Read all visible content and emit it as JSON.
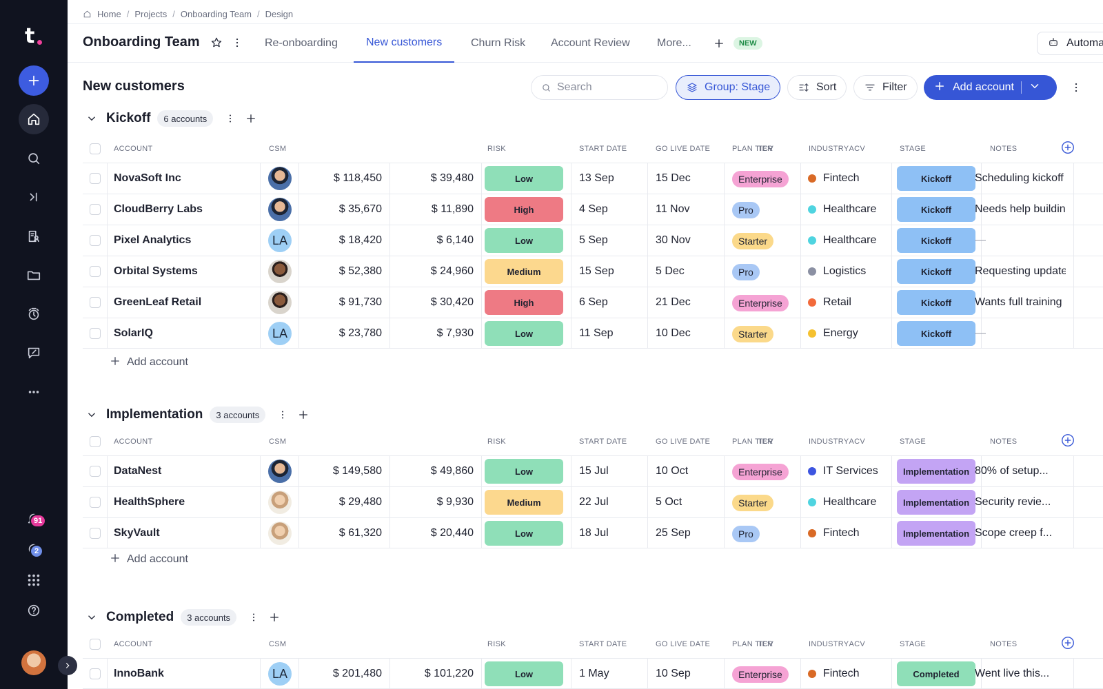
{
  "breadcrumb": [
    "Home",
    "Projects",
    "Onboarding Team",
    "Design"
  ],
  "header": {
    "title": "Onboarding Team",
    "tabs": [
      "Re-onboarding",
      "New customers",
      "Churn Risk",
      "Account Review",
      "More..."
    ],
    "active_tab": "New customers",
    "new_badge": "NEW",
    "automate_label": "Automate"
  },
  "sidebar": {
    "notifications_count": "91",
    "messages_count": "2",
    "icons": [
      "plus-icon",
      "home-icon",
      "search-icon",
      "skip-forward-icon",
      "user-list-icon",
      "folder-icon",
      "timer-icon",
      "feedback-icon",
      "more-horizontal-icon",
      "bell-icon",
      "chat-icon",
      "apps-grid-icon",
      "help-icon"
    ]
  },
  "toolbar": {
    "section_title": "New customers",
    "search_placeholder": "Search",
    "group_label": "Group: Stage",
    "sort_label": "Sort",
    "filter_label": "Filter",
    "add_account_label": "Add account"
  },
  "columns": [
    "ACCOUNT",
    "CSM",
    "TCV",
    "ACV",
    "RISK",
    "START DATE",
    "GO LIVE DATE",
    "PLAN TIER",
    "INDUSTRY",
    "STAGE",
    "NOTES"
  ],
  "add_row_label": "Add account",
  "colors": {
    "accent": "#3656d6",
    "risk_low": "#8fdfb8",
    "risk_high": "#ee7a84",
    "risk_medium": "#fcd88e",
    "tier_enterprise": "#f5a3d4",
    "tier_pro": "#a9c8f5",
    "tier_starter": "#fbd98a",
    "stage_kickoff": "#8ec0f5",
    "stage_implementation": "#c3a4f4",
    "stage_completed": "#8fdfb8"
  },
  "groups": [
    {
      "name": "Kickoff",
      "count": "6 accounts",
      "rows": [
        {
          "account": "NovaSoft Inc",
          "csm": "photo1",
          "tcv": "$ 118,450",
          "acv": "$ 39,480",
          "risk": "Low",
          "start": "13 Sep",
          "golive": "15 Dec",
          "tier": "Enterprise",
          "industry": "Fintech",
          "industry_color": "#d96a26",
          "stage": "Kickoff",
          "notes": "Scheduling kickoff"
        },
        {
          "account": "CloudBerry Labs",
          "csm": "photo1",
          "tcv": "$ 35,670",
          "acv": "$ 11,890",
          "risk": "High",
          "start": "4 Sep",
          "golive": "11 Nov",
          "tier": "Pro",
          "industry": "Healthcare",
          "industry_color": "#4fd4e0",
          "stage": "Kickoff",
          "notes": "Needs help building"
        },
        {
          "account": "Pixel Analytics",
          "csm": "LA",
          "tcv": "$ 18,420",
          "acv": "$ 6,140",
          "risk": "Low",
          "start": "5 Sep",
          "golive": "30 Nov",
          "tier": "Starter",
          "industry": "Healthcare",
          "industry_color": "#4fd4e0",
          "stage": "Kickoff",
          "notes": "—"
        },
        {
          "account": "Orbital Systems",
          "csm": "photo2",
          "tcv": "$ 52,380",
          "acv": "$ 24,960",
          "risk": "Medium",
          "start": "15 Sep",
          "golive": "5 Dec",
          "tier": "Pro",
          "industry": "Logistics",
          "industry_color": "#8b90a3",
          "stage": "Kickoff",
          "notes": "Requesting updates"
        },
        {
          "account": "GreenLeaf Retail",
          "csm": "photo2",
          "tcv": "$ 91,730",
          "acv": "$ 30,420",
          "risk": "High",
          "start": "6 Sep",
          "golive": "21 Dec",
          "tier": "Enterprise",
          "industry": "Retail",
          "industry_color": "#f26a3b",
          "stage": "Kickoff",
          "notes": "Wants full training"
        },
        {
          "account": "SolarIQ",
          "csm": "LA",
          "tcv": "$ 23,780",
          "acv": "$ 7,930",
          "risk": "Low",
          "start": "11 Sep",
          "golive": "10 Dec",
          "tier": "Starter",
          "industry": "Energy",
          "industry_color": "#f5c130",
          "stage": "Kickoff",
          "notes": "—"
        }
      ]
    },
    {
      "name": "Implementation",
      "count": "3 accounts",
      "rows": [
        {
          "account": "DataNest",
          "csm": "photo1",
          "tcv": "$ 149,580",
          "acv": "$ 49,860",
          "risk": "Low",
          "start": "15 Jul",
          "golive": "10 Oct",
          "tier": "Enterprise",
          "industry": "IT Services",
          "industry_color": "#3d55e0",
          "stage": "Implementation",
          "notes": "80% of setup..."
        },
        {
          "account": "HealthSphere",
          "csm": "photo3",
          "tcv": "$ 29,480",
          "acv": "$ 9,930",
          "risk": "Medium",
          "start": "22 Jul",
          "golive": "5 Oct",
          "tier": "Starter",
          "industry": "Healthcare",
          "industry_color": "#4fd4e0",
          "stage": "Implementation",
          "notes": "Security revie..."
        },
        {
          "account": "SkyVault",
          "csm": "photo3",
          "tcv": "$ 61,320",
          "acv": "$ 20,440",
          "risk": "Low",
          "start": "18 Jul",
          "golive": "25 Sep",
          "tier": "Pro",
          "industry": "Fintech",
          "industry_color": "#d96a26",
          "stage": "Implementation",
          "notes": "Scope creep f..."
        }
      ]
    },
    {
      "name": "Completed",
      "count": "3 accounts",
      "rows": [
        {
          "account": "InnoBank",
          "csm": "LA",
          "tcv": "$ 201,480",
          "acv": "$ 101,220",
          "risk": "Low",
          "start": "1 May",
          "golive": "10 Sep",
          "tier": "Enterprise",
          "industry": "Fintech",
          "industry_color": "#d96a26",
          "stage": "Completed",
          "notes": "Went live this..."
        }
      ]
    }
  ]
}
